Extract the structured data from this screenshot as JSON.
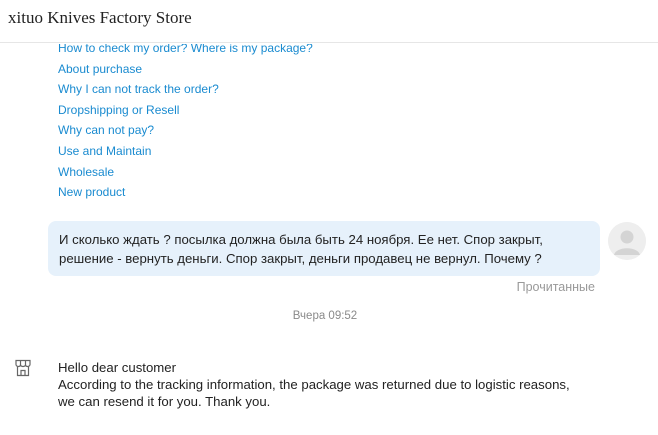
{
  "header": {
    "title": "xituo Knives Factory Store"
  },
  "faq": {
    "links": [
      "How to check my order? Where is my package?",
      "About purchase",
      "Why I can not track the order?",
      "Dropshipping or Resell",
      "Why can not pay?",
      "Use and Maintain",
      "Wholesale",
      "New product"
    ]
  },
  "outgoing": {
    "text": "И сколько ждать ? посылка должна была быть 24 ноября. Ее нет. Спор закрыт, решение - вернуть деньги. Спор закрыт, деньги продавец не вернул. Почему ?",
    "status": "Прочитанные"
  },
  "divider": {
    "time": "Вчера 09:52"
  },
  "incoming": {
    "greeting": "Hello dear customer",
    "body": "According to the tracking information, the package was returned due to logistic reasons, we can resend it for you. Thank you."
  },
  "colors": {
    "link": "#1a8bd0",
    "bubble": "#e6f1fb",
    "muted": "#999999"
  },
  "icons": {
    "avatar": "user-avatar-icon",
    "shop": "shop-icon"
  }
}
